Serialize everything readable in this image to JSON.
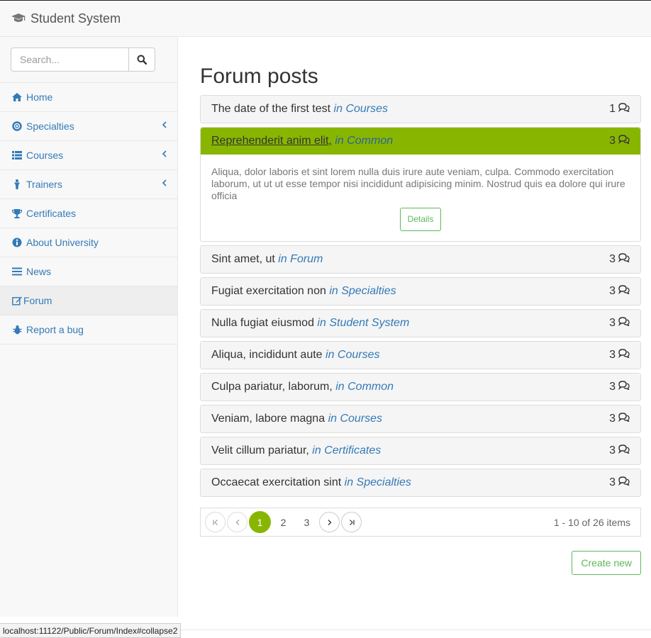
{
  "app": {
    "title": "Student System",
    "brand_icon": "graduation-cap-icon"
  },
  "sidebar": {
    "search_placeholder": "Search...",
    "items": [
      {
        "label": "Home",
        "icon": "home-icon",
        "has_submenu": false
      },
      {
        "label": "Specialties",
        "icon": "life-ring-icon",
        "has_submenu": true
      },
      {
        "label": "Courses",
        "icon": "list-icon",
        "has_submenu": true
      },
      {
        "label": "Trainers",
        "icon": "person-icon",
        "has_submenu": true
      },
      {
        "label": "Certificates",
        "icon": "trophy-icon",
        "has_submenu": false
      },
      {
        "label": "About University",
        "icon": "info-icon",
        "has_submenu": false
      },
      {
        "label": "News",
        "icon": "bars-icon",
        "has_submenu": false
      },
      {
        "label": "Forum",
        "icon": "edit-icon",
        "has_submenu": false,
        "active": true
      },
      {
        "label": "Report a bug",
        "icon": "bug-icon",
        "has_submenu": false
      }
    ]
  },
  "main": {
    "title": "Forum posts",
    "posts": [
      {
        "title": "The date of the first test",
        "category": "in Courses",
        "count": "1"
      },
      {
        "title": "Reprehenderit anim elit,",
        "category": "in Common",
        "count": "3",
        "expanded": true,
        "body": "Aliqua, dolor laboris et sint lorem nulla duis irure aute veniam, culpa. Commodo exercitation laborum, ut ut ut esse tempor nisi incididunt adipisicing minim. Nostrud quis ea dolore qui irure officia",
        "details_label": "Details"
      },
      {
        "title": "Sint amet, ut",
        "category": "in Forum",
        "count": "3"
      },
      {
        "title": "Fugiat exercitation non",
        "category": "in Specialties",
        "count": "3"
      },
      {
        "title": "Nulla fugiat eiusmod",
        "category": "in Student System",
        "count": "3"
      },
      {
        "title": "Aliqua, incididunt aute",
        "category": "in Courses",
        "count": "3"
      },
      {
        "title": "Culpa pariatur, laborum,",
        "category": "in Common",
        "count": "3"
      },
      {
        "title": "Veniam, labore magna",
        "category": "in Courses",
        "count": "3"
      },
      {
        "title": "Velit cillum pariatur,",
        "category": "in Certificates",
        "count": "3"
      },
      {
        "title": "Occaecat exercitation sint",
        "category": "in Specialties",
        "count": "3"
      }
    ],
    "pager": {
      "pages": [
        "1",
        "2",
        "3"
      ],
      "current": "1",
      "info": "1 - 10 of 26 items"
    },
    "create_label": "Create new"
  },
  "status_url": "localhost:11122/Public/Forum/Index#collapse2",
  "colors": {
    "accent": "#88b600",
    "link": "#337ab7",
    "success": "#5cb85c"
  }
}
